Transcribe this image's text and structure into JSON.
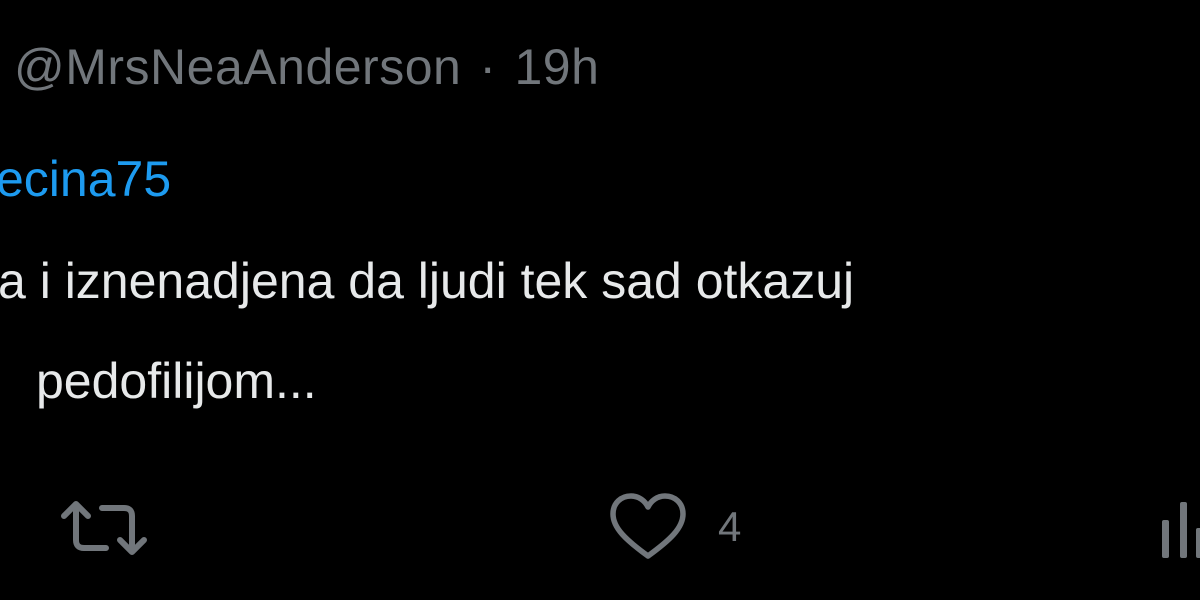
{
  "tweet": {
    "handle": "@MrsNeaAnderson",
    "separator": "·",
    "time": "19h",
    "mention": "ecina75",
    "text_line1": "a i iznenadjena da ljudi tek sad otkazuj",
    "text_line2": "pedofilijom..."
  },
  "actions": {
    "retweet_icon": "retweet-icon",
    "like_icon": "heart-icon",
    "like_count": "4",
    "views_icon": "views-icon"
  },
  "colors": {
    "background": "#000000",
    "muted": "#71767b",
    "text": "#e7e9ea",
    "link": "#1d9bf0"
  }
}
